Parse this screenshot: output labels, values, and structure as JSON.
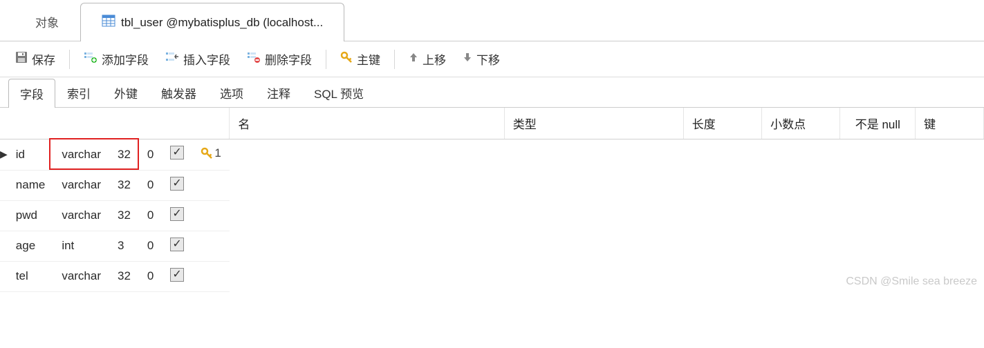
{
  "topTabs": {
    "objects": "对象",
    "activeLabel": "tbl_user @mybatisplus_db (localhost..."
  },
  "toolbar": {
    "save": "保存",
    "addField": "添加字段",
    "insertField": "插入字段",
    "deleteField": "删除字段",
    "primaryKey": "主键",
    "moveUp": "上移",
    "moveDown": "下移"
  },
  "subTabs": {
    "fields": "字段",
    "indexes": "索引",
    "foreignKeys": "外键",
    "triggers": "触发器",
    "options": "选项",
    "comment": "注释",
    "sqlPreview": "SQL 预览"
  },
  "columns": {
    "name": "名",
    "type": "类型",
    "length": "长度",
    "decimals": "小数点",
    "notNull": "不是 null",
    "key": "键"
  },
  "rows": [
    {
      "current": true,
      "name": "id",
      "type": "varchar",
      "length": "32",
      "decimals": "0",
      "notNull": true,
      "keyIndex": "1",
      "highlight": true
    },
    {
      "current": false,
      "name": "name",
      "type": "varchar",
      "length": "32",
      "decimals": "0",
      "notNull": true,
      "keyIndex": "",
      "highlight": false
    },
    {
      "current": false,
      "name": "pwd",
      "type": "varchar",
      "length": "32",
      "decimals": "0",
      "notNull": true,
      "keyIndex": "",
      "highlight": false
    },
    {
      "current": false,
      "name": "age",
      "type": "int",
      "length": "3",
      "decimals": "0",
      "notNull": true,
      "keyIndex": "",
      "highlight": false
    },
    {
      "current": false,
      "name": "tel",
      "type": "varchar",
      "length": "32",
      "decimals": "0",
      "notNull": true,
      "keyIndex": "",
      "highlight": false
    }
  ],
  "watermark": "CSDN @Smile sea breeze"
}
